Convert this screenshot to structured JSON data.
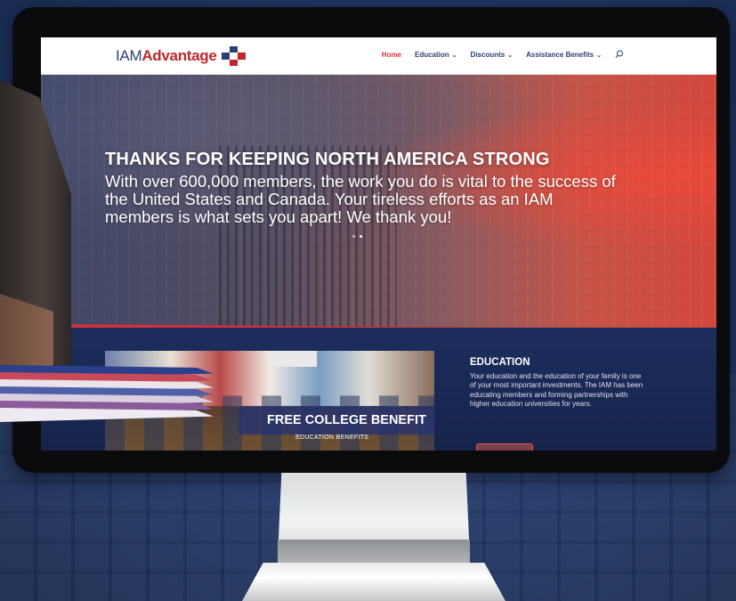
{
  "nav": {
    "logo_iam": "IAM",
    "logo_advantage": "Advantage",
    "logo_icon": "medical-cross-logo-icon",
    "items": [
      {
        "label": "Home",
        "active": true,
        "has_dropdown": false
      },
      {
        "label": "Education",
        "active": false,
        "has_dropdown": true
      },
      {
        "label": "Discounts",
        "active": false,
        "has_dropdown": true
      },
      {
        "label": "Assistance Benefits",
        "active": false,
        "has_dropdown": true
      }
    ],
    "search_icon": "search-icon"
  },
  "hero": {
    "title": "THANKS FOR KEEPING NORTH AMERICA STRONG",
    "body": "With over 600,000 members, the work you do is vital to the success of the United States and Canada.  Your tireless efforts as an IAM members is what sets you apart!  We thank you!",
    "slides": 2,
    "active_slide": 1
  },
  "promo": {
    "title": "FREE COLLEGE BENEFIT",
    "subtitle": "EDUCATION BENEFITS"
  },
  "education": {
    "title": "EDUCATION",
    "body": "Your education and the education of your family is one of your most important investments. The IAM has been educating members and forming partnerships with higher education universities for years."
  },
  "colors": {
    "brand_blue": "#2a3f72",
    "brand_red": "#c0262d",
    "nav_active": "#e0323a",
    "section_dark": "#1d2e5e"
  }
}
